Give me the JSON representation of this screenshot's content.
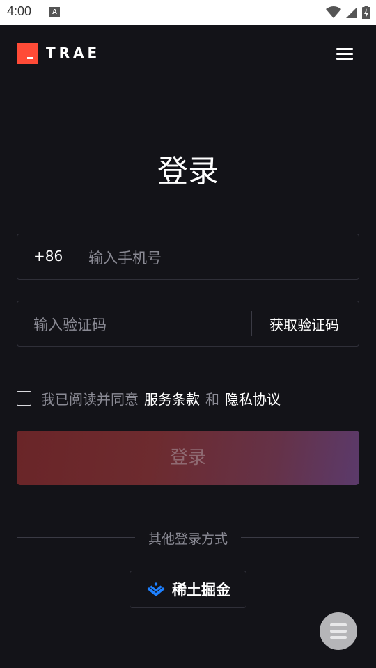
{
  "status_bar": {
    "time": "4:00",
    "notification_glyph": "A"
  },
  "header": {
    "brand": "TRAE",
    "menu_icon": "hamburger-icon"
  },
  "page": {
    "title": "登录"
  },
  "phone_field": {
    "country_code": "+86",
    "placeholder": "输入手机号"
  },
  "code_field": {
    "placeholder": "输入验证码",
    "get_code_label": "获取验证码"
  },
  "agreement": {
    "prefix": "我已阅读并同意",
    "terms": "服务条款",
    "and": "和",
    "privacy": "隐私协议",
    "checked": false
  },
  "login_button": {
    "label": "登录"
  },
  "other_login": {
    "label": "其他登录方式",
    "provider": "稀土掘金"
  },
  "colors": {
    "brand": "#ff4b37",
    "background": "#131318",
    "muted_text": "#8a8a94"
  }
}
